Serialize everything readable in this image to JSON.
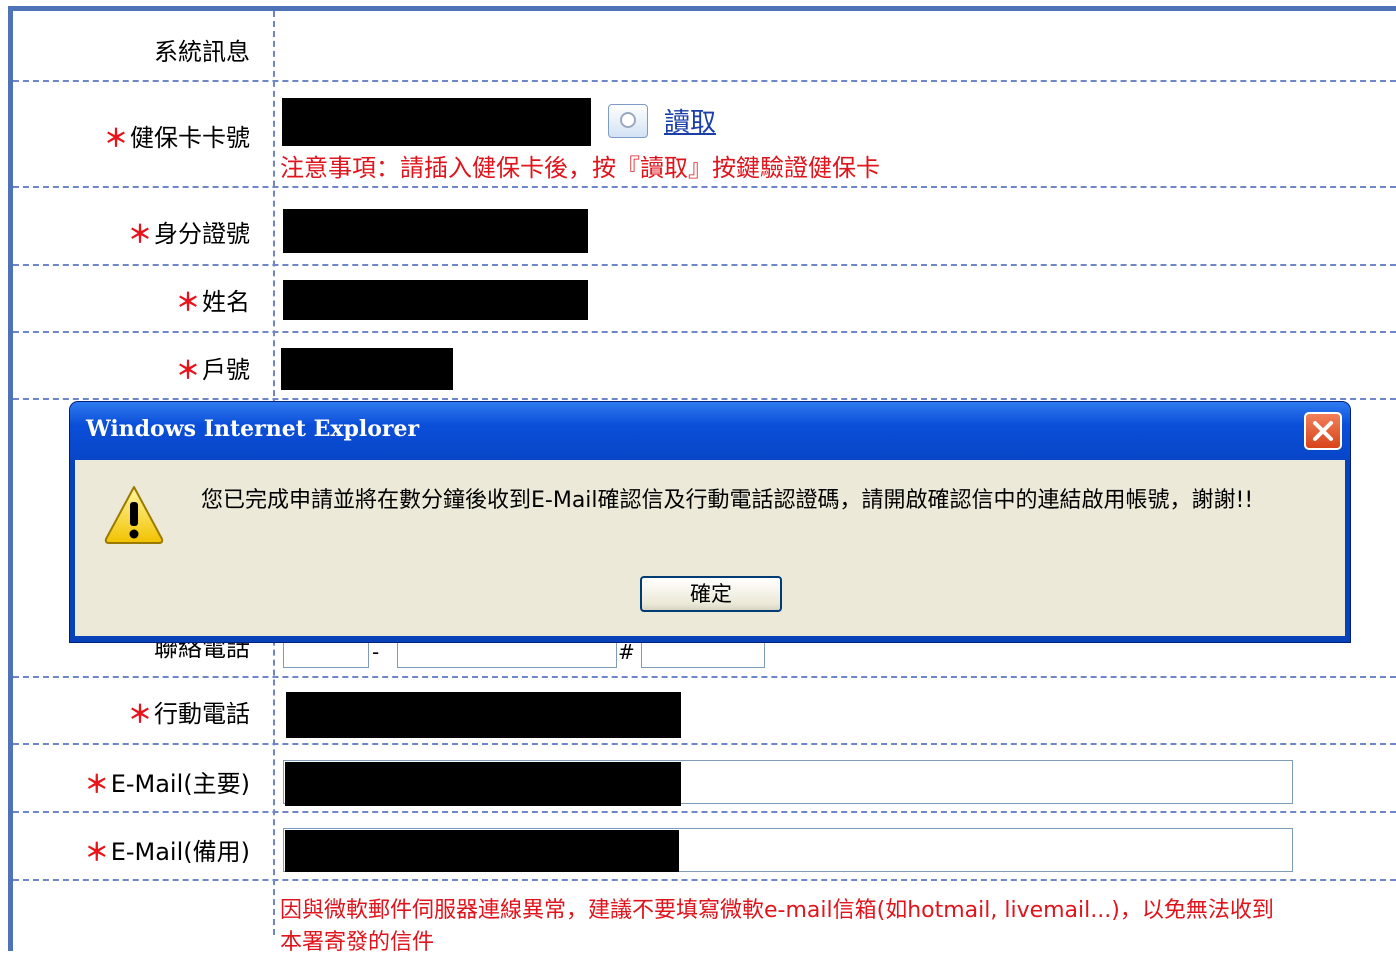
{
  "form": {
    "system_message_label": "系統訊息",
    "required_mark": "＊",
    "health_card_label": "健保卡卡號",
    "read_label": "讀取",
    "health_card_note": "注意事項：請插入健保卡後，按『讀取』按鍵驗證健保卡",
    "id_label": "身分證號",
    "name_label": "姓名",
    "household_label": "戶號",
    "phone_label": "聯絡電話",
    "phone_dash": "-",
    "phone_ext": "#",
    "mobile_label": "行動電話",
    "email_primary_label": "E-Mail(主要)",
    "email_backup_label": "E-Mail(備用)",
    "footer_note_line1": "因與微軟郵件伺服器連線異常，建議不要填寫微軟e-mail信箱(如hotmail, livemail...)，以免無法收到",
    "footer_note_line2": "本署寄發的信件"
  },
  "dialog": {
    "title": "Windows Internet Explorer",
    "message": "您已完成申請並將在數分鐘後收到E-Mail確認信及行動電話認證碼，請開啟確認信中的連結啟用帳號，謝謝!!",
    "ok_label": "確定",
    "icon": "warning-icon"
  },
  "colors": {
    "required": "#e8141c",
    "border": "#4f73b8",
    "dialog_titlebar": "#0a4ed8"
  }
}
